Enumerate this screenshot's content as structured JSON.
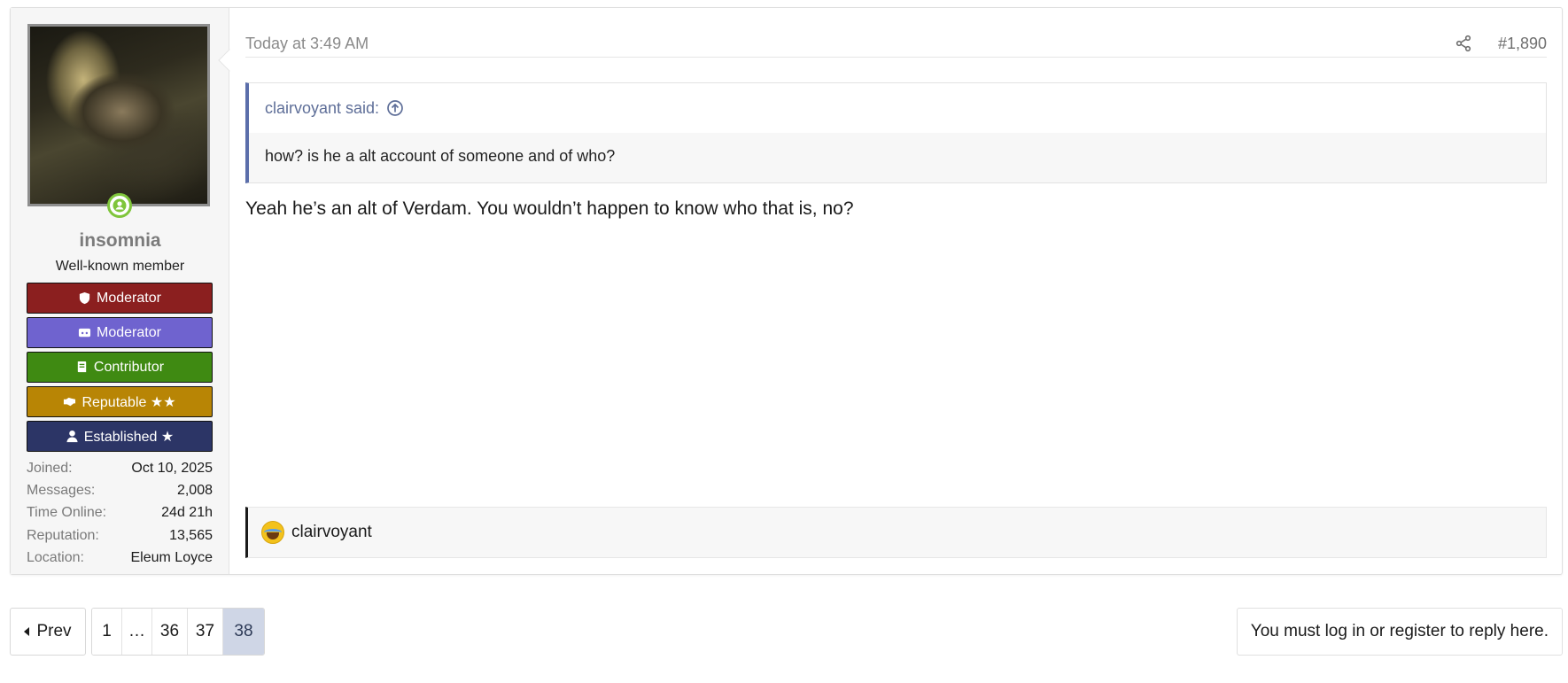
{
  "user": {
    "name": "insomnia",
    "title": "Well-known member",
    "banners": [
      {
        "label": "Moderator",
        "icon": "shield-icon"
      },
      {
        "label": "Moderator",
        "icon": "discord-icon"
      },
      {
        "label": "Contributor",
        "icon": "book-icon"
      },
      {
        "label": "Reputable ★★",
        "icon": "handshake-icon"
      },
      {
        "label": "Established ★",
        "icon": "user-icon"
      }
    ],
    "stats": [
      {
        "key": "Joined:",
        "value": "Oct 10, 2025"
      },
      {
        "key": "Messages:",
        "value": "2,008"
      },
      {
        "key": "Time Online:",
        "value": "24d 21h"
      },
      {
        "key": "Reputation:",
        "value": "13,565"
      },
      {
        "key": "Location:",
        "value": "Eleum Loyce"
      }
    ]
  },
  "post": {
    "date": "Today at 3:49 AM",
    "number": "#1,890",
    "quote": {
      "author_line": "clairvoyant said:",
      "text": "how? is he a alt account of someone and of who?"
    },
    "message": "Yeah he’s an alt of Verdam. You wouldn’t happen to know who that is, no?",
    "reaction": {
      "icon": "laughing-emoji-icon",
      "user": "clairvoyant"
    }
  },
  "pagination": {
    "prev_label": "Prev",
    "pages": [
      "1",
      "…",
      "36",
      "37",
      "38"
    ],
    "current": "38"
  },
  "reply_notice": "You must log in or register to reply here.",
  "colors": {
    "moderator_red": "#8b1f1f",
    "moderator_purple": "#6f63cf",
    "contributor_green": "#3f8a12",
    "reputable_gold": "#b88505",
    "established_navy": "#2c3566",
    "quote_accent": "#5b6eaa"
  }
}
